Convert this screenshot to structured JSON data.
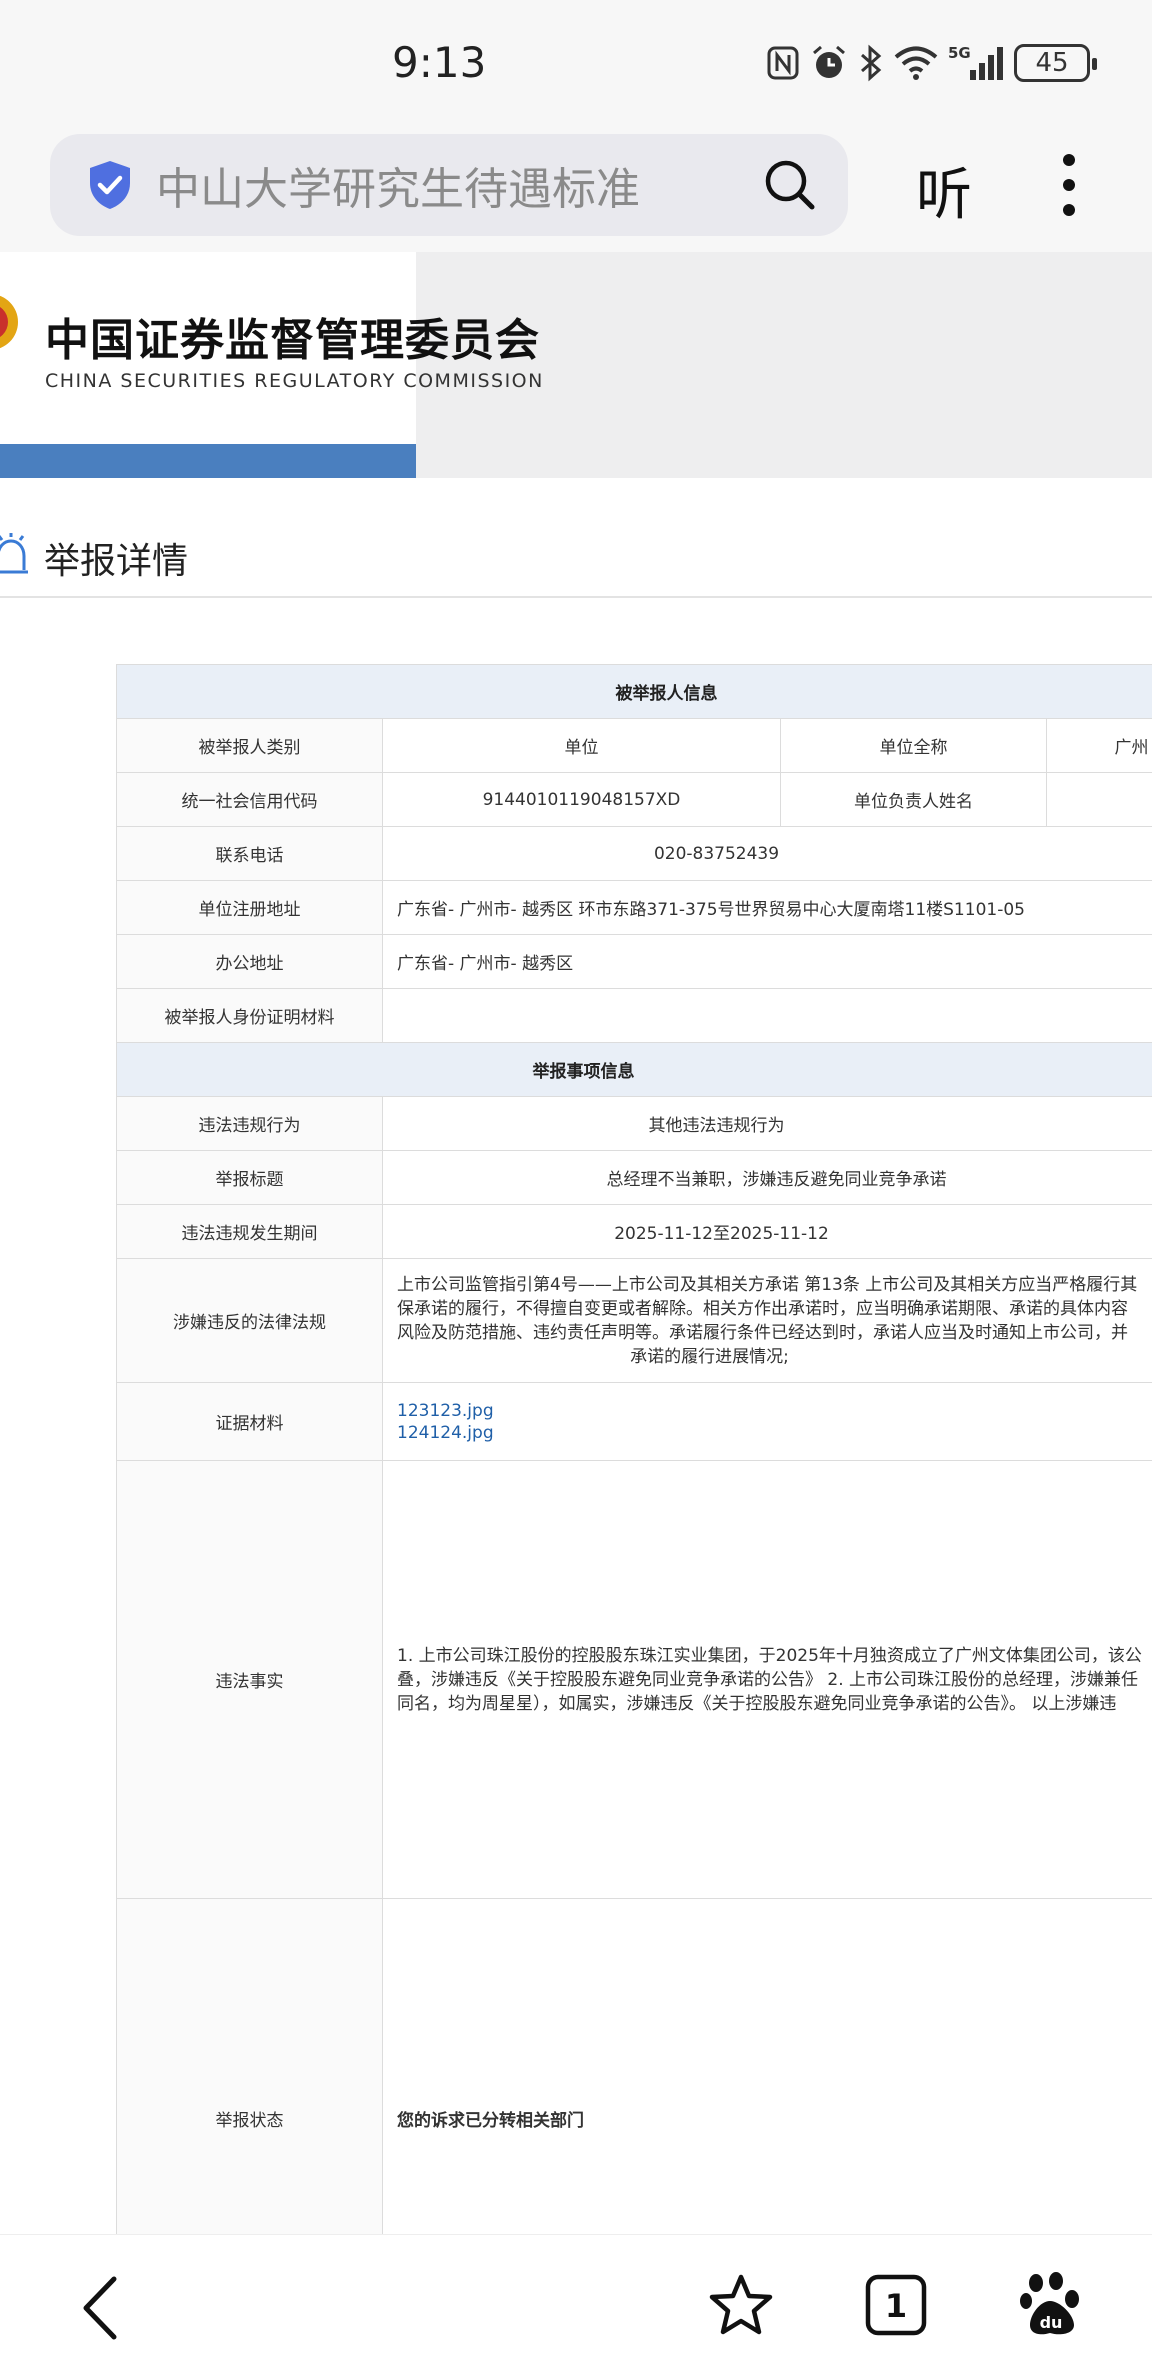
{
  "status_bar": {
    "time": "9:13",
    "network": "5G",
    "battery": "45",
    "icons": [
      "nfc-icon",
      "alarm-icon",
      "bluetooth-icon",
      "wifi-icon",
      "signal-icon",
      "battery-icon"
    ]
  },
  "browser": {
    "search_text": "中山大学研究生待遇标准",
    "listen_label": "听"
  },
  "site": {
    "title_cn": "中国证券监督管理委员会",
    "title_en": "CHINA SECURITIES REGULATORY COMMISSION"
  },
  "section": {
    "title": "举报详情"
  },
  "table": {
    "reported_header": "被举报人信息",
    "rows1": [
      {
        "label": "被举报人类别",
        "value": "单位",
        "label2": "单位全称",
        "value2": "广州"
      },
      {
        "label": "统一社会信用代码",
        "value": "9144010119048157XD",
        "label2": "单位负责人姓名",
        "value2": ""
      }
    ],
    "phone": {
      "label": "联系电话",
      "value": "020-83752439"
    },
    "reg_addr": {
      "label": "单位注册地址",
      "value": "广东省- 广州市- 越秀区 环市东路371-375号世界贸易中心大厦南塔11楼S1101-05"
    },
    "office_addr": {
      "label": "办公地址",
      "value": "广东省- 广州市- 越秀区"
    },
    "id_material": {
      "label": "被举报人身份证明材料",
      "value": ""
    },
    "matter_header": "举报事项信息",
    "violation": {
      "label": "违法违规行为",
      "value": "其他违法违规行为"
    },
    "report_title": {
      "label": "举报标题",
      "value": "总经理不当兼职，涉嫌违反避免同业竞争承诺"
    },
    "period": {
      "label": "违法违规发生期间",
      "value": "2025-11-12至2025-11-12"
    },
    "law": {
      "label": "涉嫌违反的法律法规",
      "lines": [
        "上市公司监管指引第4号——上市公司及其相关方承诺 第13条 上市公司及其相关方应当严格履行其",
        "保承诺的履行，不得擅自变更或者解除。相关方作出承诺时，应当明确承诺期限、承诺的具体内容",
        "风险及防范措施、违约责任声明等。承诺履行条件已经达到时，承诺人应当及时通知上市公司，并",
        "承诺的履行进展情况;"
      ]
    },
    "evidence": {
      "label": "证据材料",
      "files": [
        "123123.jpg",
        "124124.jpg"
      ]
    },
    "facts": {
      "label": "违法事实",
      "lines": [
        "1. 上市公司珠江股份的控股股东珠江实业集团，于2025年十月独资成立了广州文体集团公司，该公",
        "叠，涉嫌违反《关于控股股东避免同业竞争承诺的公告》 2. 上市公司珠江股份的总经理，涉嫌兼任",
        "同名，均为周星星），如属实，涉嫌违反《关于控股股东避免同业竞争承诺的公告》。 以上涉嫌违"
      ]
    },
    "status": {
      "label": "举报状态",
      "value": "您的诉求已分转相关部门"
    }
  },
  "nav": {
    "tab_count": "1",
    "icons": [
      "back-icon",
      "star-icon",
      "tabs-icon",
      "baidu-paw-icon"
    ]
  }
}
